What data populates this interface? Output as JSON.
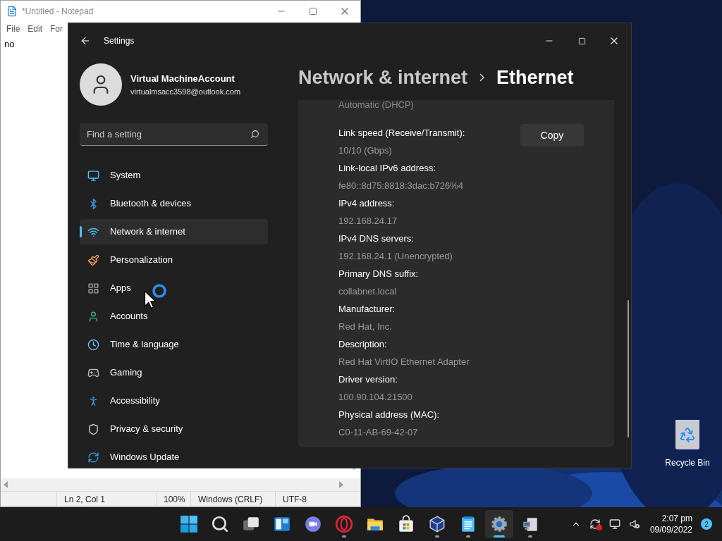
{
  "notepad": {
    "title": "*Untitled - Notepad",
    "menu": [
      "File",
      "Edit",
      "For"
    ],
    "text": "no",
    "status_bar": [
      "Ln 2, Col 1",
      "100%",
      "Windows (CRLF)",
      "UTF-8"
    ]
  },
  "settings": {
    "title": "Settings",
    "account": {
      "name": "Virtual MachineAccount",
      "email": "virtualmsacc3598@outlook.com"
    },
    "search": {
      "placeholder": "Find a setting"
    },
    "nav": [
      {
        "kind": "system",
        "label": "System",
        "selected": false
      },
      {
        "kind": "bluetooth",
        "label": "Bluetooth & devices",
        "selected": false
      },
      {
        "kind": "network",
        "label": "Network & internet",
        "selected": true
      },
      {
        "kind": "personalization",
        "label": "Personalization",
        "selected": false
      },
      {
        "kind": "apps",
        "label": "Apps",
        "selected": false
      },
      {
        "kind": "accounts",
        "label": "Accounts",
        "selected": false
      },
      {
        "kind": "time",
        "label": "Time & language",
        "selected": false
      },
      {
        "kind": "gaming",
        "label": "Gaming",
        "selected": false
      },
      {
        "kind": "accessibility",
        "label": "Accessibility",
        "selected": false
      },
      {
        "kind": "privacy",
        "label": "Privacy & security",
        "selected": false
      },
      {
        "kind": "update",
        "label": "Windows Update",
        "selected": false
      }
    ],
    "breadcrumb": [
      "Network & internet",
      "Ethernet"
    ],
    "cut_value": "Automatic (DHCP)",
    "properties": [
      {
        "label": "Link speed (Receive/Transmit):",
        "value": "10/10 (Gbps)"
      },
      {
        "label": "Link-local IPv6 address:",
        "value": "fe80::8d75:8818:3dac:b726%4"
      },
      {
        "label": "IPv4 address:",
        "value": "192.168.24.17"
      },
      {
        "label": "IPv4 DNS servers:",
        "value": "192.168.24.1 (Unencrypted)"
      },
      {
        "label": "Primary DNS suffix:",
        "value": "collabnet.local"
      },
      {
        "label": "Manufacturer:",
        "value": "Red Hat, Inc."
      },
      {
        "label": "Description:",
        "value": "Red Hat VirtIO Ethernet Adapter"
      },
      {
        "label": "Driver version:",
        "value": "100.90.104.21500"
      },
      {
        "label": "Physical address (MAC):",
        "value": "C0-11-AB-69-42-07"
      }
    ],
    "copy_button": "Copy"
  },
  "desktop": {
    "icons": [
      {
        "label": "Recycle Bin"
      }
    ]
  },
  "taskbar": {
    "apps": [
      {
        "kind": "start",
        "running": false,
        "active": false
      },
      {
        "kind": "search",
        "running": false,
        "active": false
      },
      {
        "kind": "taskview",
        "running": false,
        "active": false
      },
      {
        "kind": "widgets",
        "running": false,
        "active": false
      },
      {
        "kind": "chat",
        "running": false,
        "active": false
      },
      {
        "kind": "opera",
        "running": true,
        "active": false
      },
      {
        "kind": "explorer",
        "running": false,
        "active": false
      },
      {
        "kind": "store",
        "running": false,
        "active": false
      },
      {
        "kind": "virtualbox",
        "running": true,
        "active": false
      },
      {
        "kind": "notepad",
        "running": true,
        "active": false
      },
      {
        "kind": "settings",
        "running": true,
        "active": true
      },
      {
        "kind": "installer",
        "running": true,
        "active": false
      }
    ],
    "time": "2:07 pm",
    "date": "09/09/2022",
    "notifications": "2"
  }
}
